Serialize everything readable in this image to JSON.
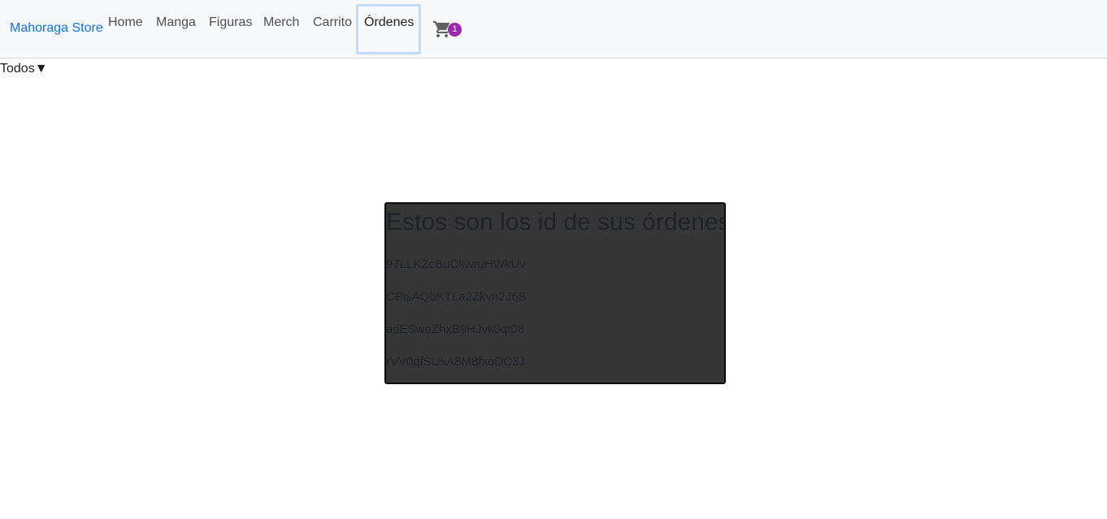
{
  "navbar": {
    "brand": "Mahoraga Store",
    "links": [
      "Home",
      "Manga",
      "Figuras",
      "Merch",
      "Carrito",
      "Órdenes"
    ],
    "active_link": "Órdenes",
    "cart_icon": "shopping-cart-icon",
    "cart_count": "1",
    "colors": {
      "background": "#f8f9fa",
      "brand": "#0d6efd",
      "badge": "#9c27b0"
    }
  },
  "filter": {
    "label": "Todos",
    "caret": "▼"
  },
  "orders": {
    "title": "Estos son los id de sus órdenes:",
    "ids": [
      "97LLKZcBuCltwruHWkUv",
      "CPisAQbKTLa2Zkvn2J6B",
      "adESwoZhxB9HJvk0qt08",
      "rVV0qfSUxA8M8fxoDC3J"
    ],
    "colors": {
      "panel": "#363637",
      "text": "#1f2227"
    }
  }
}
